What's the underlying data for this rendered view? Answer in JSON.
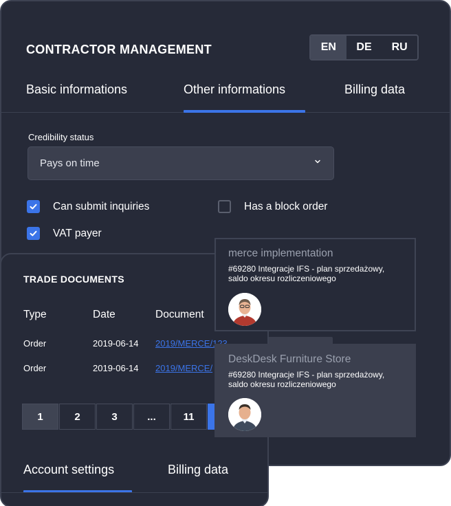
{
  "header": {
    "title": "CONTRACTOR MANAGEMENT",
    "languages": [
      "EN",
      "DE",
      "RU"
    ],
    "active_language": "EN"
  },
  "tabs": [
    {
      "label": "Basic informations",
      "active": false
    },
    {
      "label": "Other informations",
      "active": true
    },
    {
      "label": "Billing data",
      "active": false
    }
  ],
  "credibility": {
    "label": "Credibility status",
    "value": "Pays on time",
    "icon": "chevron-down-icon"
  },
  "checkboxes": [
    {
      "label": "Can submit inquiries",
      "checked": true
    },
    {
      "label": "Has a block order",
      "checked": false
    },
    {
      "label": "VAT payer",
      "checked": true
    }
  ],
  "trade_documents": {
    "title": "TRADE DOCUMENTS",
    "columns": [
      "Type",
      "Date",
      "Document"
    ],
    "rows": [
      {
        "type": "Order",
        "date": "2019-06-14",
        "document": "2019/MERCE/123"
      },
      {
        "type": "Order",
        "date": "2019-06-14",
        "document": "2019/MERCE/"
      }
    ],
    "pagination": [
      "1",
      "2",
      "3",
      "...",
      "11"
    ],
    "active_page": "1"
  },
  "bottom_tabs": [
    {
      "label": "Account settings",
      "active": true
    },
    {
      "label": "Billing data",
      "active": false
    }
  ],
  "popups": [
    {
      "title": "merce implementation",
      "description": "#69280 Integracje IFS - plan sprzedażowy, saldo okresu rozliczeniowego"
    },
    {
      "title": "DeskDesk Furniture Store",
      "description": "#69280 Integracje IFS - plan sprzedażowy, saldo okresu rozliczeniowego"
    }
  ],
  "colors": {
    "background": "#262a38",
    "accent": "#3b74e8",
    "input": "#3b3f4e",
    "border": "#3d4252"
  }
}
